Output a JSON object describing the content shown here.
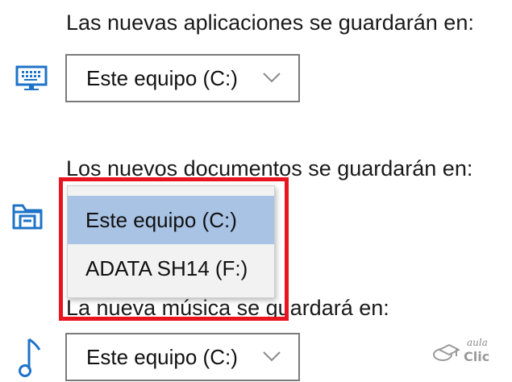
{
  "apps": {
    "label": "Las nuevas aplicaciones se guardarán en:",
    "icon": "monitor-icon",
    "selected": "Este equipo (C:)"
  },
  "documents": {
    "label": "Los nuevos documentos se guardarán en:",
    "icon": "folder-icon",
    "dropdown_options": [
      "Este equipo (C:)",
      "ADATA SH14 (F:)"
    ],
    "selected_index": 0
  },
  "music": {
    "label": "La nueva música se guardará en:",
    "icon": "music-note-icon",
    "selected": "Este equipo (C:)"
  },
  "logo": {
    "text_top": "aula",
    "text_bottom": "Clic"
  },
  "colors": {
    "highlight_border": "#e8141f",
    "selected_option": "#a9c3e4",
    "icon_blue": "#1e73c8"
  }
}
